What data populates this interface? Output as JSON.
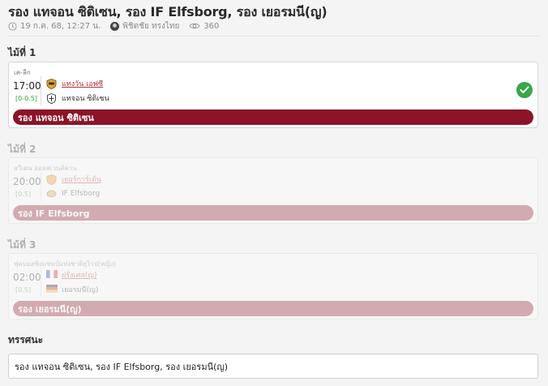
{
  "post": {
    "title": "รอง แทจอน ซิติเซน, รอง IF Elfsborg, รอง เยอรมนี(ญ)",
    "date": "19 ก.ค. 68, 12:27 น.",
    "author": "พิชิตชัย ทรงไทย",
    "views": "360"
  },
  "picks": [
    {
      "label": "ไม้ที่ 1",
      "league": "เค-ลีก",
      "time": "17:00",
      "handicap": "[0-0.5]",
      "home": "แทงวัน เอฟซี",
      "away": "แทจอน ซิติเซน",
      "selection": "รอง แทจอน ซิติเซน",
      "status": "win",
      "bar_color": "#8b1428"
    },
    {
      "label": "ไม้ที่ 2",
      "league": "สวีเดน ออลสเวนส์คาน",
      "time": "20:00",
      "handicap": "[0.5]",
      "home": "เยอร์การ์เด้น",
      "away": "IF Elfsborg",
      "selection": "รอง IF Elfsborg",
      "status": "pending",
      "bar_color": "#8b1428"
    },
    {
      "label": "ไม้ที่ 3",
      "league": "ฟุตบอลชิงแชมป์แห่งชาติยุโรป(หญิง)",
      "time": "02:00",
      "handicap": "[0.5]",
      "home": "ฝรั่งเศส(ญ)",
      "away": "เยอรมนี(ญ)",
      "selection": "รอง เยอรมนี(ญ)",
      "status": "pending",
      "bar_color": "#8b1428"
    }
  ],
  "opinion": {
    "label": "ทรรศนะ",
    "text": "รอง แทจอน ซิติเซน, รอง IF Elfsborg, รอง เยอรมนี(ญ)"
  },
  "icons": {
    "clock": "clock-icon",
    "eye": "eye-icon",
    "check": "check-icon"
  },
  "colors": {
    "accent": "#8b1428",
    "win": "#3aa64b",
    "handicap": "#2e9e3a",
    "link": "#b0303a"
  }
}
